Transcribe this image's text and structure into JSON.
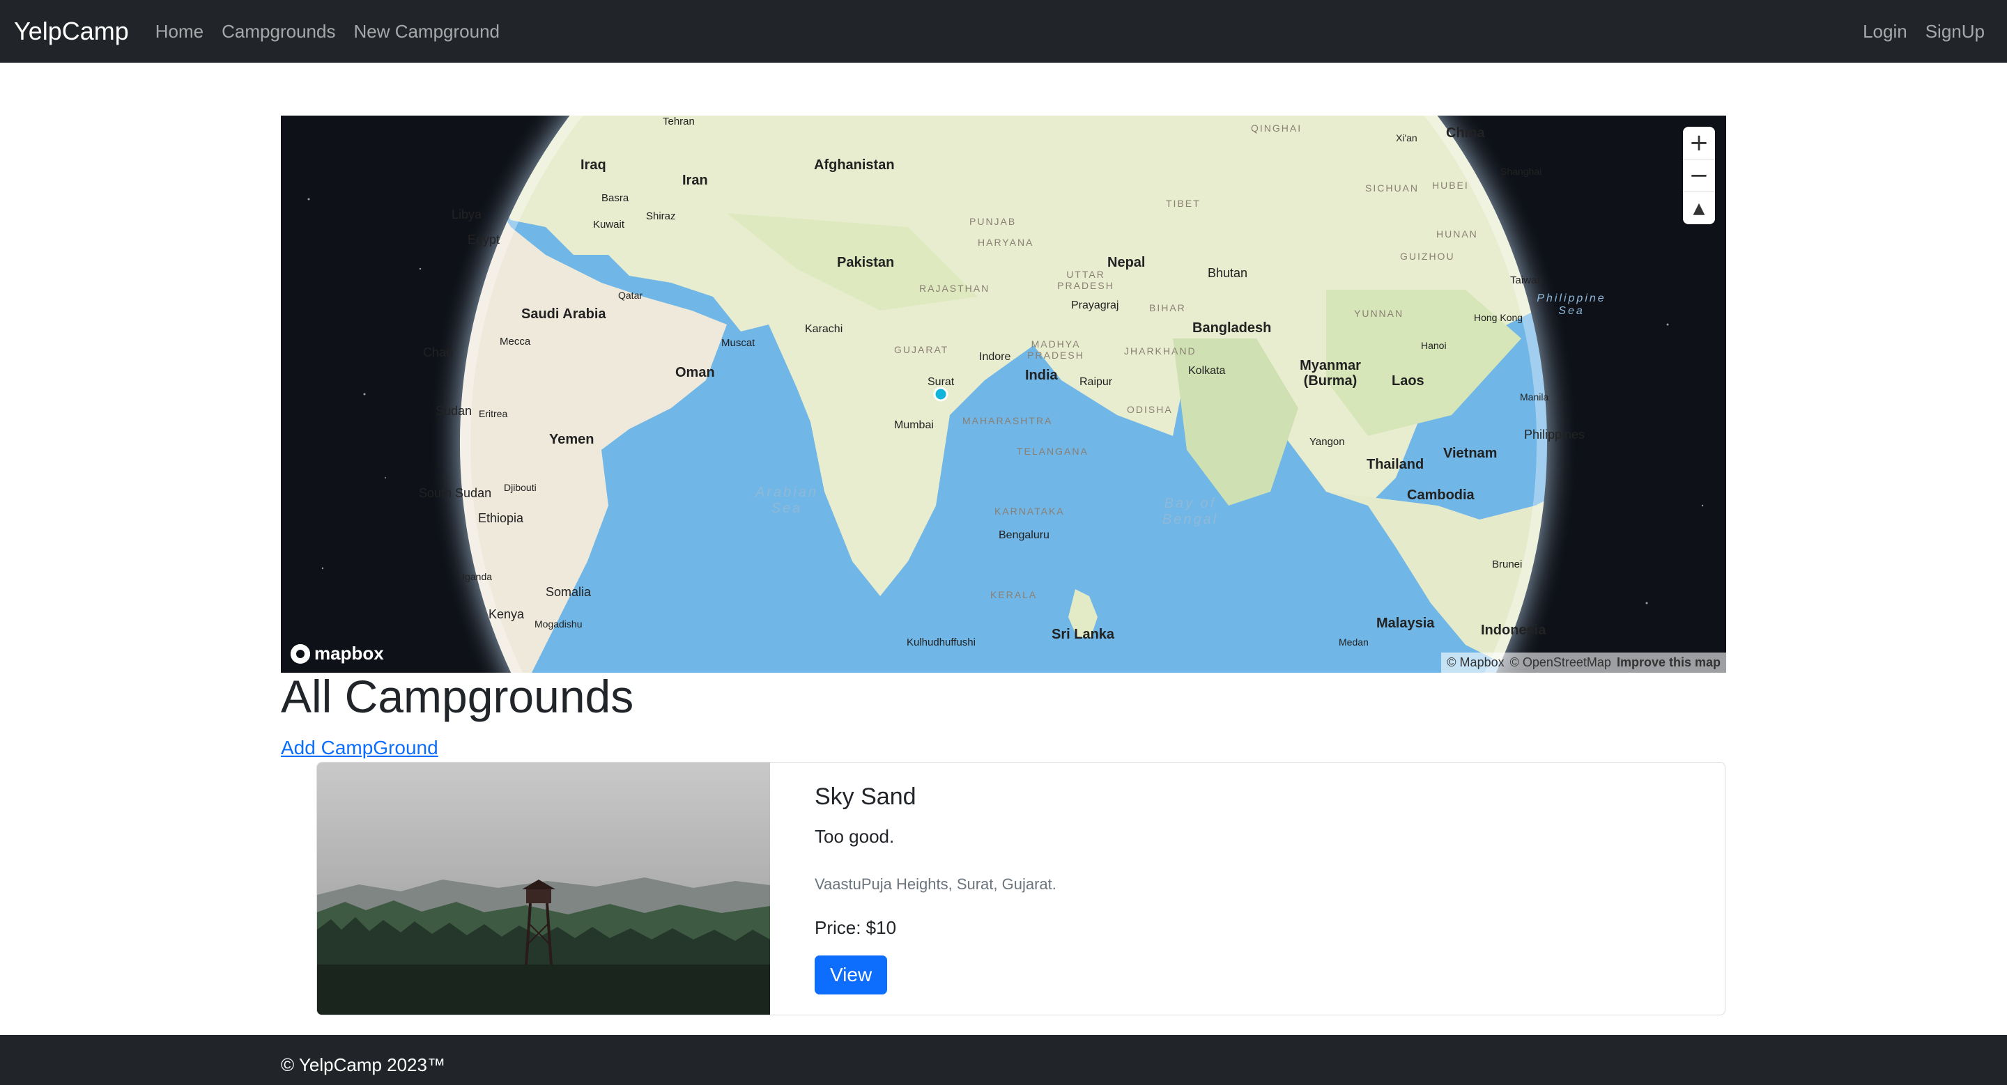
{
  "navbar": {
    "brand": "YelpCamp",
    "links": [
      "Home",
      "Campgrounds",
      "New Campground"
    ],
    "right_links": [
      "Login",
      "SignUp"
    ]
  },
  "map": {
    "zoom_in": "+",
    "zoom_out": "−",
    "compass": "▲",
    "logo": "mapbox",
    "attribution": [
      "© Mapbox",
      "© OpenStreetMap",
      "Improve this map"
    ],
    "labels": {
      "countries": [
        "China",
        "Afghanistan",
        "Iraq",
        "Iran",
        "Pakistan",
        "Nepal",
        "Bhutan",
        "Bangladesh",
        "India",
        "Saudi Arabia",
        "Oman",
        "Yemen",
        "Egypt",
        "Libya",
        "Sudan",
        "Ethiopia",
        "Somalia",
        "Kenya",
        "Chad",
        "Myanmar (Burma)",
        "Laos",
        "Thailand",
        "Vietnam",
        "Cambodia",
        "Philippines",
        "Sri Lanka",
        "Malaysia",
        "Indonesia",
        "South Sudan",
        "Taiwan",
        "Brunei"
      ],
      "cities": [
        "Karachi",
        "Mumbai",
        "Surat",
        "Bengaluru",
        "Kolkata",
        "Indore",
        "Raipur",
        "Prayagraj",
        "Muscat",
        "Mecca",
        "Basra",
        "Kuwait",
        "Shiraz",
        "Qatar",
        "Tehran",
        "Hong Kong",
        "Hanoi",
        "Manila",
        "Yangon",
        "Kulhudhuffushi",
        "Mogadishu",
        "Djibouti",
        "Eritrea",
        "Uganda",
        "Medan",
        "Shanghai",
        "Xi'an"
      ],
      "seas": [
        "Arabian Sea",
        "Bay of Bengal",
        "Philippine Sea"
      ],
      "regions": [
        "TIBET",
        "RAJASTHAN",
        "GUJARAT",
        "MAHARASHTRA",
        "KARNATAKA",
        "KERALA",
        "TELANGANA",
        "ODISHA",
        "JHARKHAND",
        "BIHAR",
        "UTTAR PRADESH",
        "MADHYA PRADESH",
        "PUNJAB",
        "HARYANA",
        "QINGHAI",
        "YUNNAN",
        "GUIZHOU",
        "HUNAN",
        "HUBEI",
        "SICHUAN"
      ]
    }
  },
  "page": {
    "title": "All Campgrounds",
    "add_link": "Add CampGround"
  },
  "campgrounds": [
    {
      "title": "Sky Sand",
      "description": "Too good.",
      "location": "VaastuPuja Heights, Surat, Gujarat.",
      "price": "Price: $10",
      "button": "View"
    }
  ],
  "footer": {
    "text": "© YelpCamp 2023™"
  },
  "colors": {
    "navbar_bg": "#212529",
    "primary": "#0d6efd",
    "land": "#eef0d8",
    "water": "#70b6e6",
    "space": "#0e1118"
  }
}
